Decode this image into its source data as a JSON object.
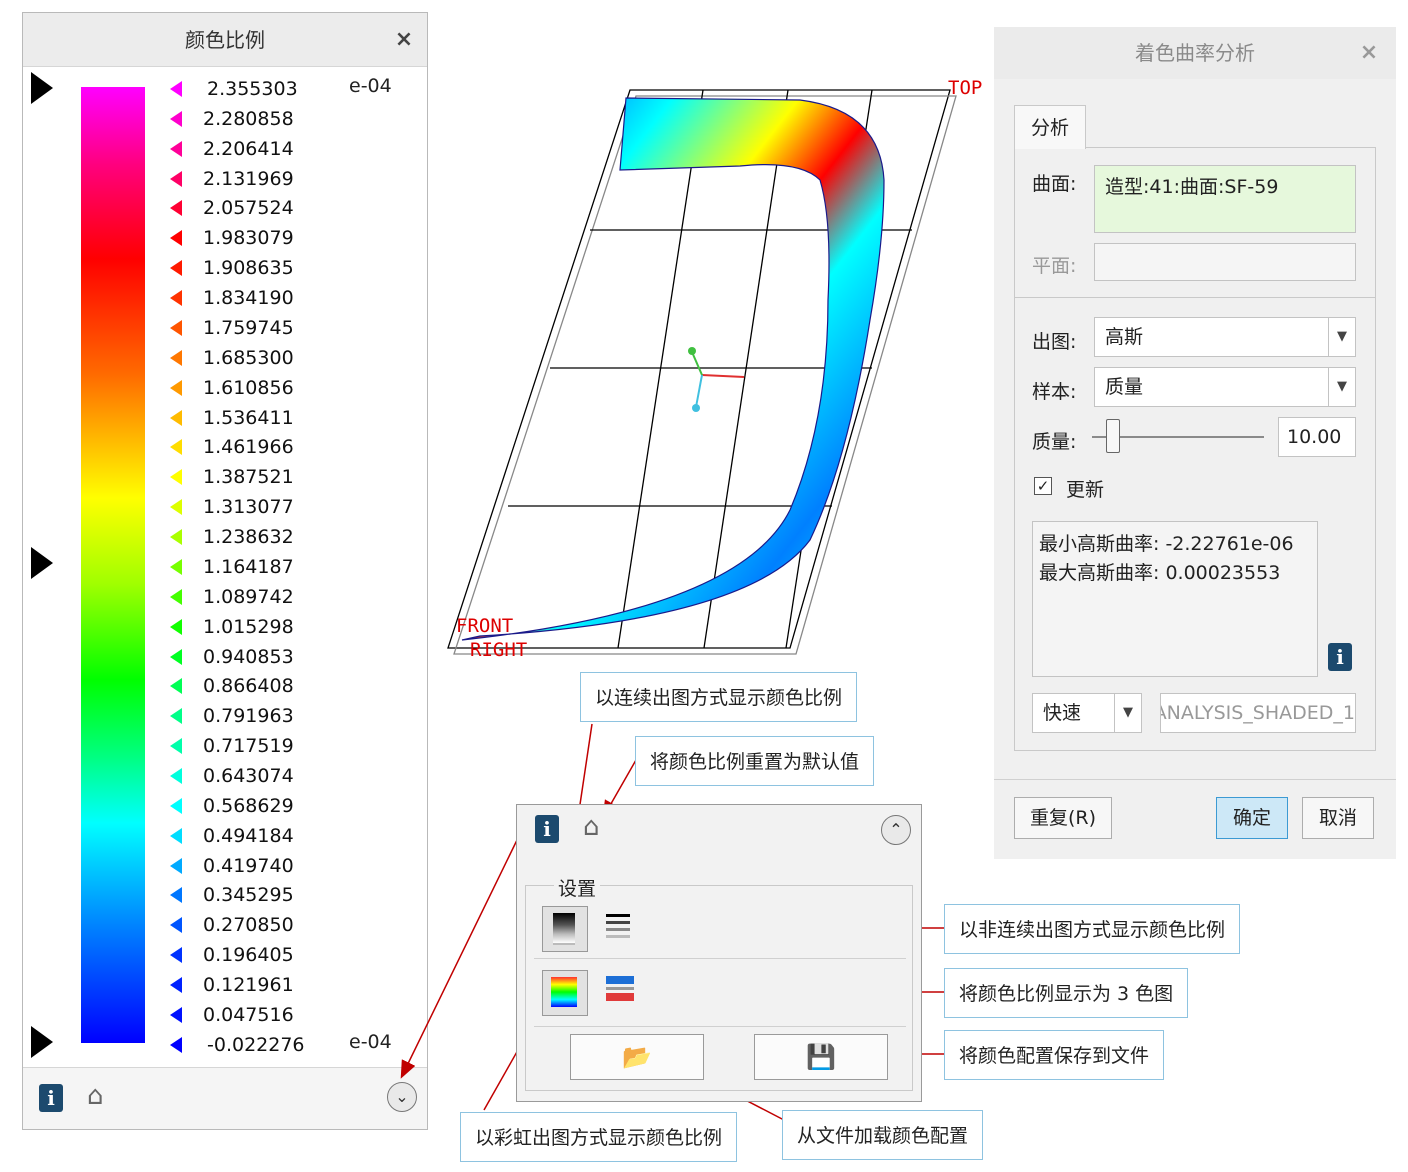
{
  "scale_panel": {
    "title": "颜色比例",
    "exponent_top": "e-04",
    "exponent_bottom": "e-04",
    "values": [
      "2.355303",
      "2.280858",
      "2.206414",
      "2.131969",
      "2.057524",
      "1.983079",
      "1.908635",
      "1.834190",
      "1.759745",
      "1.685300",
      "1.610856",
      "1.536411",
      "1.461966",
      "1.387521",
      "1.313077",
      "1.238632",
      "1.164187",
      "1.089742",
      "1.015298",
      "0.940853",
      "0.866408",
      "0.791963",
      "0.717519",
      "0.643074",
      "0.568629",
      "0.494184",
      "0.419740",
      "0.345295",
      "0.270850",
      "0.196405",
      "0.121961",
      "0.047516",
      "-0.022276"
    ],
    "tick_colors": [
      "#ff00ff",
      "#ff00cc",
      "#ff0099",
      "#ff0066",
      "#ff0033",
      "#ff0000",
      "#ff1a00",
      "#ff3300",
      "#ff5500",
      "#ff7700",
      "#ff9900",
      "#ffbb00",
      "#ffdd00",
      "#ffff00",
      "#ddff00",
      "#aaff00",
      "#77ff00",
      "#44ff00",
      "#11ff00",
      "#00ff22",
      "#00ff55",
      "#00ff88",
      "#00ffaa",
      "#00ffdd",
      "#00ffff",
      "#00ddff",
      "#00aaff",
      "#0077ff",
      "#0055ff",
      "#0033ff",
      "#0022ff",
      "#0011ff",
      "#0000ff"
    ],
    "info_label": "i",
    "home_label": "⌂",
    "expand_label": "⌄"
  },
  "viewport": {
    "label_top": "TOP",
    "label_front": "FRONT",
    "label_right": "RIGHT"
  },
  "callouts": {
    "continuous": "以连续出图方式显示颜色比例",
    "reset": "将颜色比例重置为默认值",
    "discrete": "以非连续出图方式显示颜色比例",
    "three_color": "将颜色比例显示为 3 色图",
    "save": "将颜色配置保存到文件",
    "rainbow": "以彩虹出图方式显示颜色比例",
    "load": "从文件加载颜色配置"
  },
  "settings_box": {
    "group_label": "设置",
    "collapse_label": "⌃",
    "open_label": "📂",
    "save_label": "💾"
  },
  "dialog": {
    "title": "着色曲率分析",
    "close": "×",
    "tab_analysis": "分析",
    "surface_label": "曲面:",
    "surface_value": "造型:41:曲面:SF-59",
    "plane_label": "平面:",
    "plot_label": "出图:",
    "plot_value": "高斯",
    "sample_label": "样本:",
    "sample_value": "质量",
    "quality_label": "质量:",
    "quality_value": "10.00",
    "quality_level": 0.12,
    "update_label": "更新",
    "update_checked": true,
    "result_min": "最小高斯曲率: -2.22761e-06",
    "result_max": "最大高斯曲率: 0.00023553",
    "mode_value": "快速",
    "name_value": "ANALYSIS_SHADED_1",
    "repeat_button": "重复(R)",
    "ok_button": "确定",
    "cancel_button": "取消"
  }
}
